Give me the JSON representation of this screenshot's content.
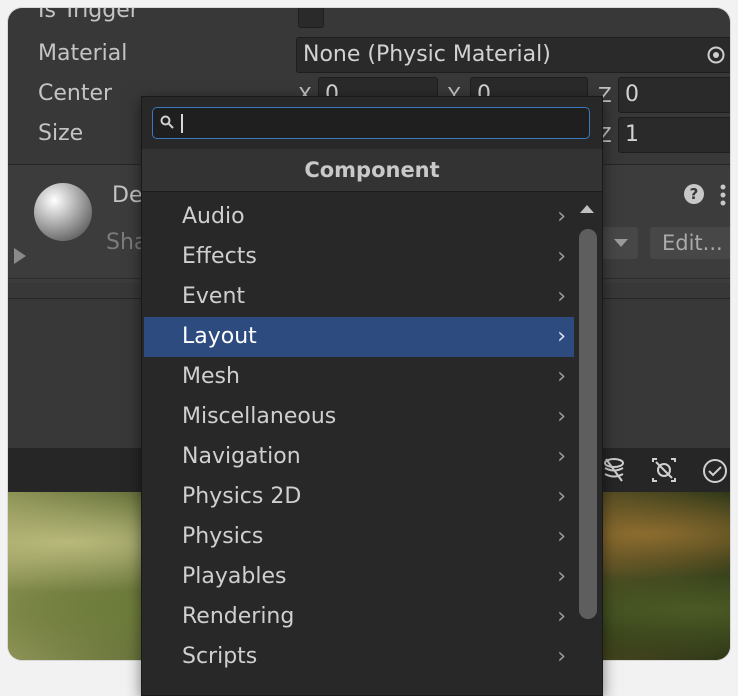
{
  "collider": {
    "is_trigger_label": "Is Trigger",
    "material_label": "Material",
    "material_value": "None (Physic Material)",
    "center_label": "Center",
    "center": {
      "x_label": "X",
      "x": "0",
      "y_label": "Y",
      "y": "0",
      "z_label": "Z",
      "z": "0"
    },
    "size_label": "Size",
    "size": {
      "z_label": "Z",
      "z": "1"
    }
  },
  "material_section": {
    "name_partial": "De",
    "shader_partial": "Sha",
    "edit_button": "Edit..."
  },
  "component_menu": {
    "title": "Component",
    "search_placeholder": "",
    "items": [
      {
        "label": "Audio"
      },
      {
        "label": "Effects"
      },
      {
        "label": "Event"
      },
      {
        "label": "Layout"
      },
      {
        "label": "Mesh"
      },
      {
        "label": "Miscellaneous"
      },
      {
        "label": "Navigation"
      },
      {
        "label": "Physics 2D"
      },
      {
        "label": "Physics"
      },
      {
        "label": "Playables"
      },
      {
        "label": "Rendering"
      },
      {
        "label": "Scripts"
      }
    ],
    "selected": "Layout"
  },
  "colors": {
    "panel_bg": "#383838",
    "selection": "#2d4b7e",
    "search_focus": "#3a79bb"
  }
}
